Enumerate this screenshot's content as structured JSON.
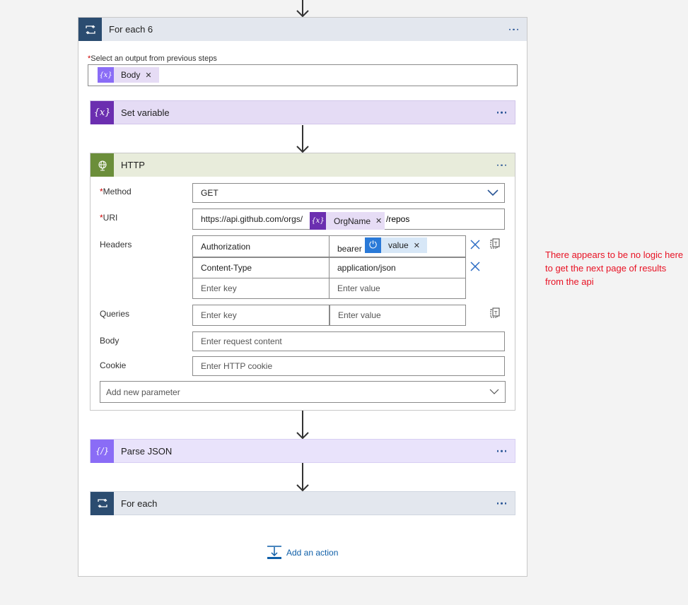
{
  "foreach6": {
    "title": "For each 6",
    "output_label": "Select an output from previous steps",
    "token_label": "Body"
  },
  "setvar": {
    "title": "Set variable"
  },
  "http": {
    "title": "HTTP",
    "method_label": "Method",
    "method_value": "GET",
    "uri_label": "URI",
    "uri_prefix": "https://api.github.com/orgs/",
    "uri_token": "OrgName",
    "uri_suffix": "/repos",
    "headers_label": "Headers",
    "headers": [
      {
        "key": "Authorization",
        "value_prefix": "bearer",
        "value_token": "value"
      },
      {
        "key": "Content-Type",
        "value": "application/json"
      }
    ],
    "key_placeholder": "Enter key",
    "value_placeholder": "Enter value",
    "queries_label": "Queries",
    "body_label": "Body",
    "body_placeholder": "Enter request content",
    "cookie_label": "Cookie",
    "cookie_placeholder": "Enter HTTP cookie",
    "add_param_placeholder": "Add new parameter"
  },
  "parsejson": {
    "title": "Parse JSON"
  },
  "foreach": {
    "title": "For each"
  },
  "add_action": "Add an action",
  "note": "There appears to be no logic here to get the next page of results from the api",
  "colors": {
    "foreach": "#2b4c70",
    "variable": "#6b2eb0",
    "http": "#6b8e3a",
    "parse": "#8a6cf6",
    "link": "#0f5fa8",
    "note": "#e81123"
  }
}
